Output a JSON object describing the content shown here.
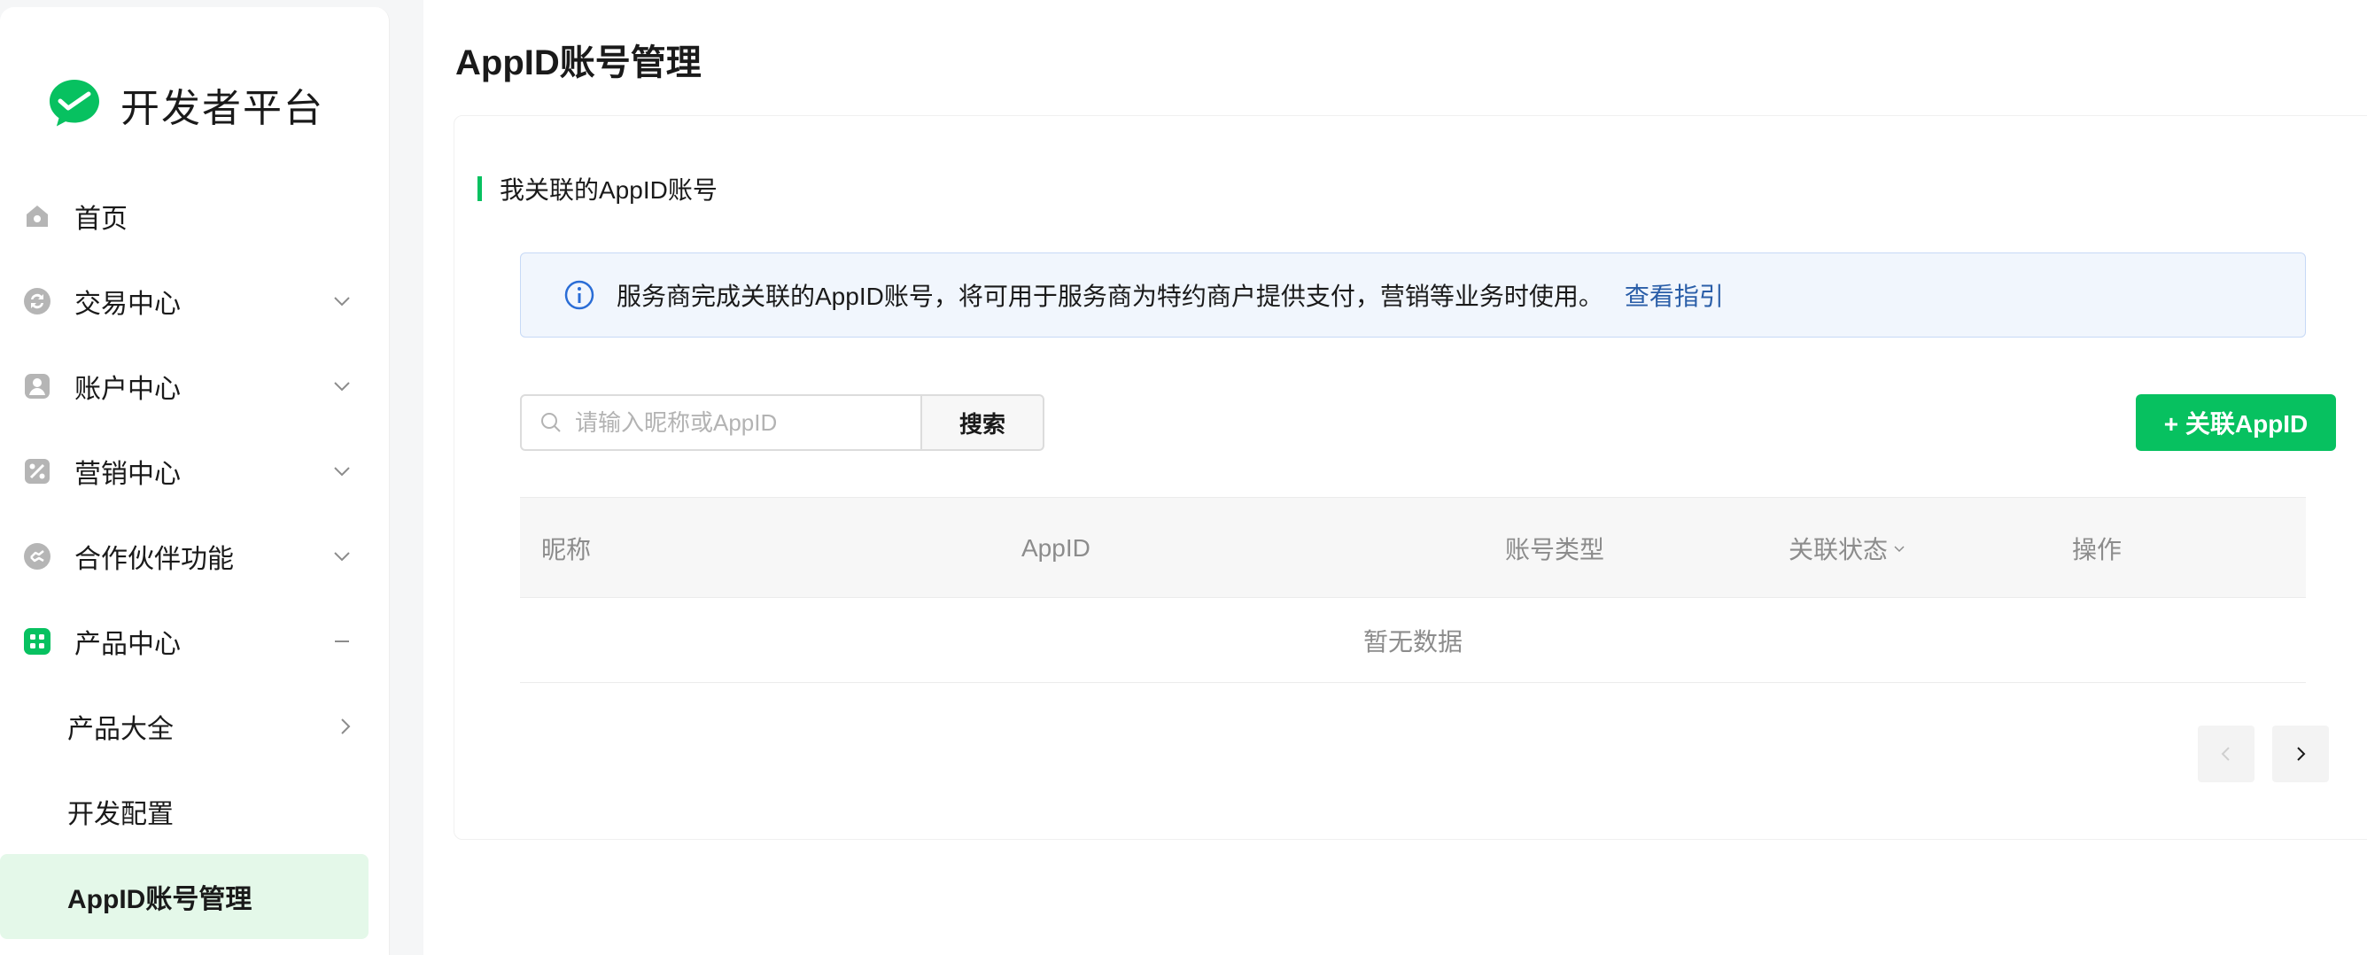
{
  "brand": {
    "name": "开发者平台"
  },
  "colors": {
    "accent": "#07c160",
    "link": "#2a5ea8",
    "active_bg": "#e4f8e9"
  },
  "sidebar": {
    "items": [
      {
        "label": "首页",
        "icon": "home-icon"
      },
      {
        "label": "交易中心",
        "icon": "exchange-icon",
        "expandable": true
      },
      {
        "label": "账户中心",
        "icon": "account-icon",
        "expandable": true
      },
      {
        "label": "营销中心",
        "icon": "percent-icon",
        "expandable": true
      },
      {
        "label": "合作伙伴功能",
        "icon": "partner-icon",
        "expandable": true
      },
      {
        "label": "产品中心",
        "icon": "product-grid-icon",
        "expanded": true
      }
    ],
    "sub_items": [
      {
        "label": "产品大全",
        "has_arrow": true
      },
      {
        "label": "开发配置"
      },
      {
        "label": "AppID账号管理",
        "active": true
      }
    ]
  },
  "page": {
    "title": "AppID账号管理"
  },
  "section": {
    "title": "我关联的AppID账号"
  },
  "notice": {
    "text": "服务商完成关联的AppID账号，将可用于服务商为特约商户提供支付，营销等业务时使用。",
    "link": "查看指引"
  },
  "search": {
    "placeholder": "请输入昵称或AppID",
    "button": "搜索"
  },
  "add_button": {
    "label": "+ 关联AppID"
  },
  "table": {
    "columns": [
      "昵称",
      "AppID",
      "账号类型",
      "关联状态",
      "操作"
    ],
    "empty_text": "暂无数据"
  }
}
